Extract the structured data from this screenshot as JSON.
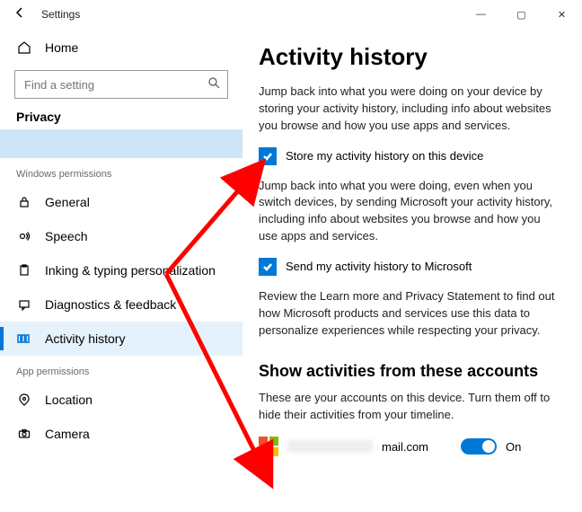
{
  "window": {
    "title": "Settings",
    "min": "—",
    "max": "▢",
    "close": "✕"
  },
  "sidebar": {
    "home": "Home",
    "search_placeholder": "Find a setting",
    "privacy": "Privacy",
    "catWin": "Windows permissions",
    "items": [
      {
        "label": "General"
      },
      {
        "label": "Speech"
      },
      {
        "label": "Inking & typing personalization"
      },
      {
        "label": "Diagnostics & feedback"
      },
      {
        "label": "Activity history"
      }
    ],
    "catApp": "App permissions",
    "appItems": [
      {
        "label": "Location"
      },
      {
        "label": "Camera"
      }
    ]
  },
  "main": {
    "h1": "Activity history",
    "p1": "Jump back into what you were doing on your device by storing your activity history, including info about websites you browse and how you use apps and services.",
    "c1": "Store my activity history on this device",
    "p2": "Jump back into what you were doing, even when you switch devices, by sending Microsoft your activity history, including info about websites you browse and how you use apps and services.",
    "c2": "Send my activity history to Microsoft",
    "p3": "Review the Learn more and Privacy Statement to find out how Microsoft products and services use this data to personalize experiences while respecting your privacy.",
    "h2": "Show activities from these accounts",
    "p4": "These are your accounts on this device. Turn them off to hide their activities from your timeline.",
    "emailSuffix": "mail.com",
    "toggleState": "On"
  }
}
